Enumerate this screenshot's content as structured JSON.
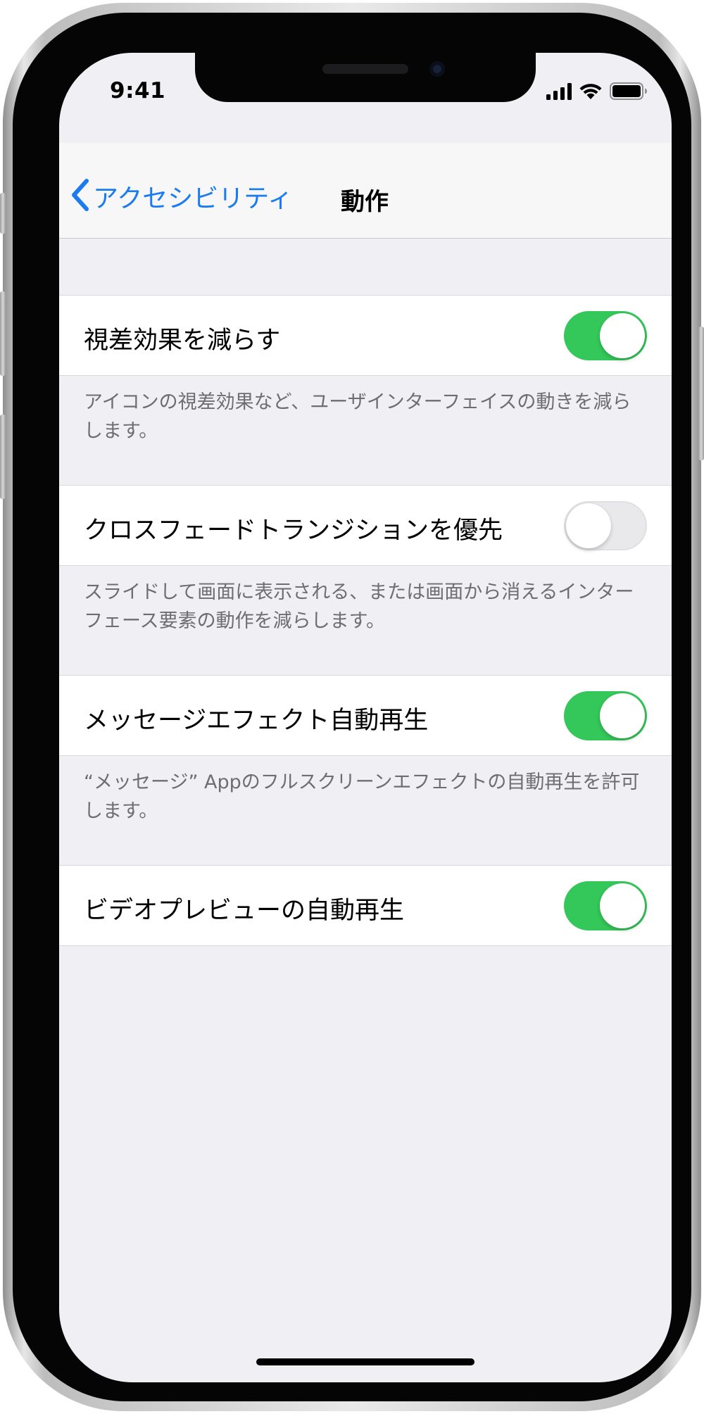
{
  "status_bar": {
    "time": "9:41"
  },
  "nav": {
    "back_label": "アクセシビリティ",
    "title": "動作"
  },
  "settings": [
    {
      "label": "視差効果を減らす",
      "on": true,
      "footer": "アイコンの視差効果など、ユーザインターフェイスの動きを減らします。"
    },
    {
      "label": "クロスフェードトランジションを優先",
      "on": false,
      "footer": "スライドして画面に表示される、または画面から消えるインターフェース要素の動作を減らします。"
    },
    {
      "label": "メッセージエフェクト自動再生",
      "on": true,
      "footer": "“メッセージ” Appのフルスクリーンエフェクトの自動再生を許可します。"
    },
    {
      "label": "ビデオプレビューの自動再生",
      "on": true,
      "footer": ""
    }
  ],
  "colors": {
    "accent": "#1a7cf0",
    "toggle_on": "#34c759",
    "toggle_off": "#e9e9eb",
    "background": "#efeff4"
  },
  "icons": {
    "back": "chevron-left-icon",
    "signal": "cellular-signal-icon",
    "wifi": "wifi-icon",
    "battery": "battery-icon"
  }
}
